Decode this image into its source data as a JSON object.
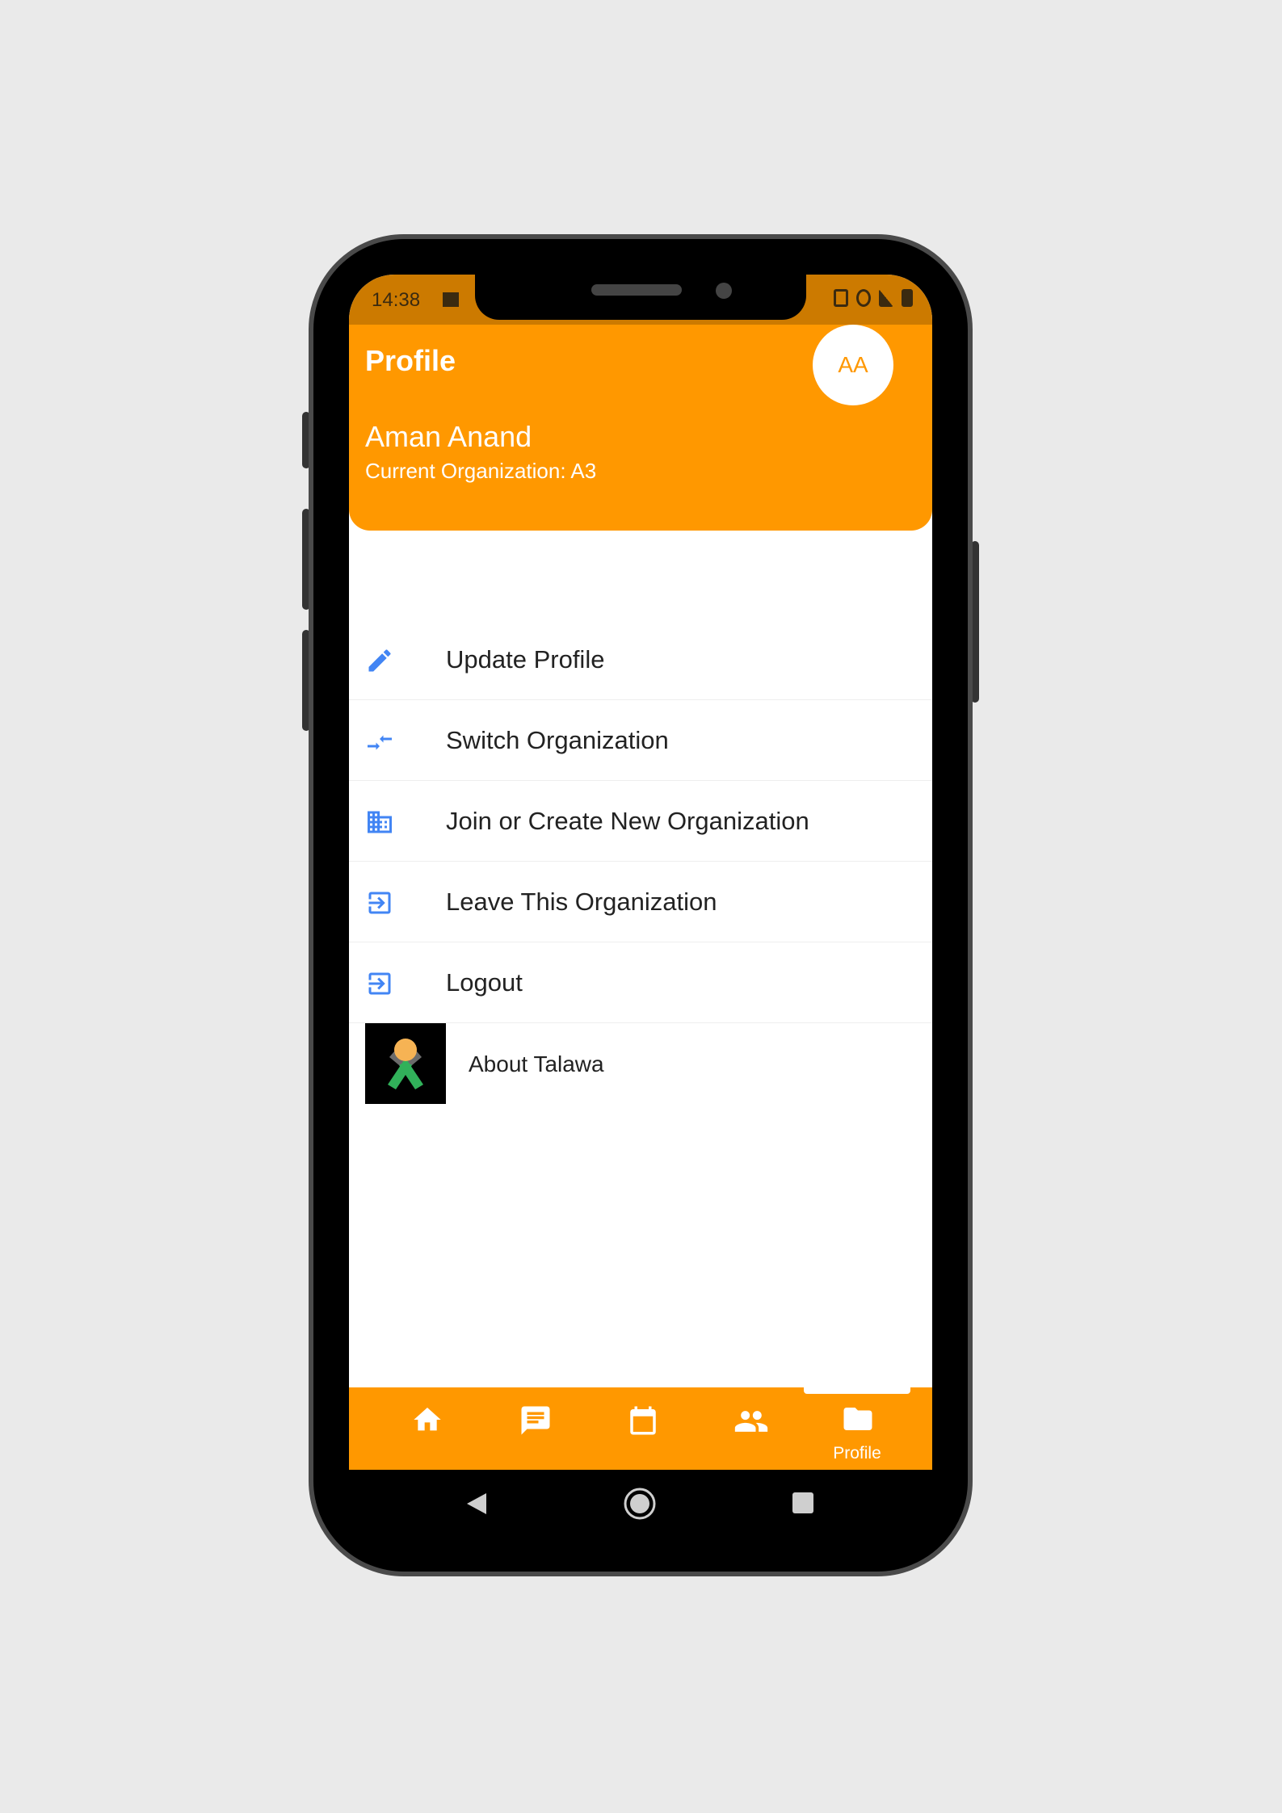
{
  "status_bar": {
    "time": "14:38"
  },
  "app_bar": {
    "title": "Profile",
    "avatar_initials": "AA"
  },
  "profile": {
    "name": "Aman Anand",
    "organization": "Current Organization: A3"
  },
  "menu": {
    "items": [
      {
        "label": "Update Profile",
        "icon": "pencil-icon"
      },
      {
        "label": "Switch Organization",
        "icon": "swap-arrows-icon"
      },
      {
        "label": "Join or Create New Organization",
        "icon": "building-icon"
      },
      {
        "label": "Leave This Organization",
        "icon": "exit-to-app-icon"
      },
      {
        "label": "Logout",
        "icon": "exit-to-app-icon"
      }
    ],
    "about_label": "About Talawa"
  },
  "bottom_nav": {
    "items": [
      {
        "icon": "home-icon"
      },
      {
        "icon": "chat-icon"
      },
      {
        "icon": "calendar-icon"
      },
      {
        "icon": "people-icon"
      },
      {
        "icon": "folder-icon",
        "label": "Profile",
        "selected": true
      }
    ]
  },
  "colors": {
    "accent": "#ff9800",
    "icon_blue": "#4285f4",
    "background": "#eaeaea"
  }
}
